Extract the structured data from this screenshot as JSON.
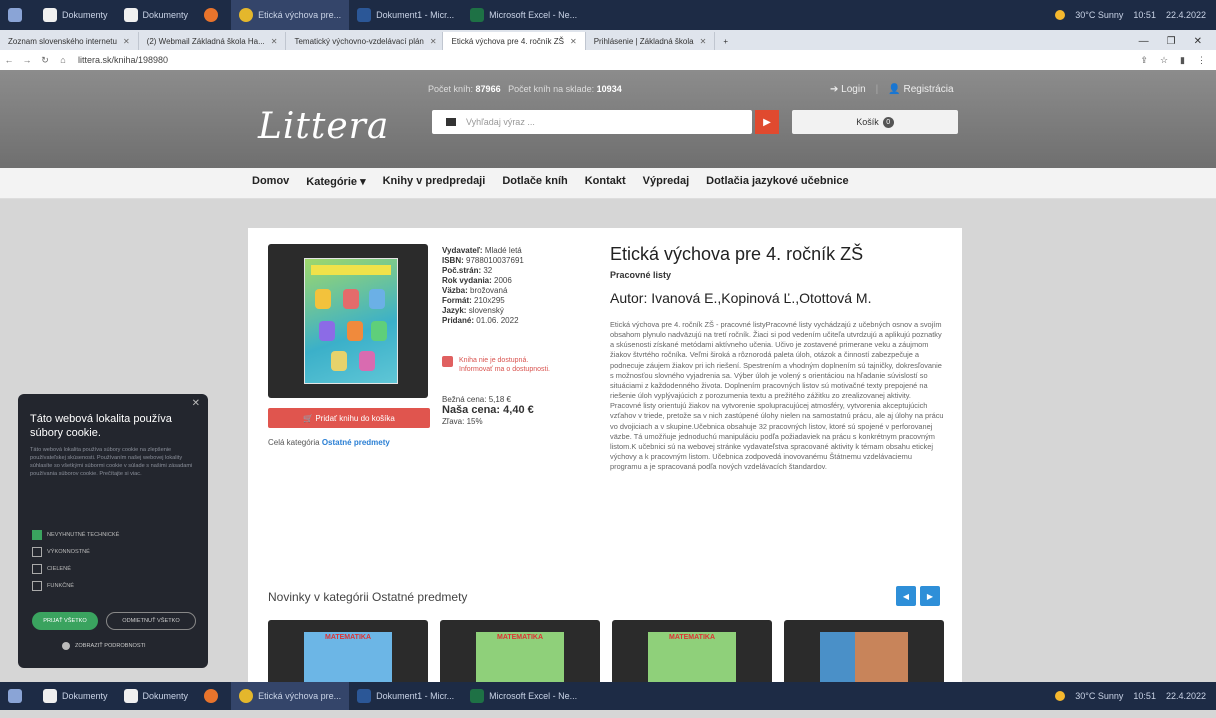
{
  "os": {
    "taskbar_items": [
      "Dokumenty",
      "Dokumenty",
      "",
      "Etická výchova pre...",
      "Dokument1 - Micr...",
      "Microsoft Excel - Ne..."
    ],
    "tray": [
      "30°C Sunny",
      "10:51",
      "22.4.2022"
    ]
  },
  "browser": {
    "tabs": [
      "Zoznam slovenského internetu",
      "(2) Webmail Základná škola Ha...",
      "Tematický výchovno-vzdelávací plán",
      "Etická výchova pre 4. ročník ZŠ",
      "Prihlásenie | Základná škola"
    ],
    "url": "littera.sk/kniha/198980"
  },
  "site": {
    "stats_label_1": "Počet kníh:",
    "stats_value_1": "87966",
    "stats_label_2": "Počet kníh na sklade:",
    "stats_value_2": "10934",
    "login": "Login",
    "register": "Registrácia",
    "logo": "Littera",
    "search_placeholder": "Vyhľadaj výraz ...",
    "cart_label": "Košík",
    "cart_count": "0",
    "nav": [
      "Domov",
      "Kategórie ▾",
      "Knihy v predpredaji",
      "Dotlače kníh",
      "Kontakt",
      "Výpredaj",
      "Dotlačia jazykové učebnice"
    ]
  },
  "book": {
    "publisher_label": "Vydavateľ:",
    "publisher": "Mladé letá",
    "isbn_label": "ISBN:",
    "isbn": "9788010037691",
    "pages_label": "Poč.strán:",
    "pages": "32",
    "year_label": "Rok vydania:",
    "year": "2006",
    "binding_label": "Väzba:",
    "binding": "brožovaná",
    "format_label": "Formát:",
    "format": "210x295",
    "language_label": "Jazyk:",
    "language": "slovenský",
    "added_label": "Pridané:",
    "added": "01.06. 2022",
    "notice": "Kniha nie je dostupná. Informovať ma o dostupnosti.",
    "regular_price_label": "Bežná cena:",
    "regular_price": "5,18 €",
    "our_price_label": "Naša cena:",
    "our_price": "4,40 €",
    "discount_label": "Zľava:",
    "discount": "15%",
    "cart_button": "Pridať knihu do košíka",
    "category_prefix": "Celá kategória",
    "category_link": "Ostatné predmety",
    "title": "Etická výchova pre 4. ročník ZŠ",
    "subtitle": "Pracovné listy",
    "author": "Autor: Ivanová E.,Kopinová Ľ.,Otottová M.",
    "description": "Etická výchova pre 4. ročník ZŠ - pracovné listyPracovné listy vychádzajú z učebných osnov a svojím obsahom plynulo nadväzujú na tretí ročník. Žiaci si pod vedením učiteľa utvrdzujú a aplikujú poznatky a skúsenosti získané metódami aktívneho učenia. Učivo je zostavené primerane veku a záujmom žiakov štvrtého ročníka. Veľmi široká a rôznorodá paleta úloh, otázok a činností zabezpečuje a podnecuje záujem žiakov pri ich riešení. Spestrením a vhodným doplnením sú tajničky, dokresľovanie s možnosťou slovného vyjadrenia sa. Výber úloh je volený s orientáciou na hľadanie súvislostí so situáciami z každodenného života. Doplnením pracovných listov sú motivačné texty prepojené na riešenie úloh vyplývajúcich z porozumenia textu a prežitého zážitku zo zrealizovanej aktivity. Pracovné listy orientujú žiakov na vytvorenie spolupracujúcej atmosféry, vytvorenia akceptujúcich vzťahov v triede, pretože sa v nich zastúpené úlohy nielen na samostatnú prácu, ale aj úlohy na prácu vo dvojiciach a v skupine.Učebnica obsahuje 32 pracovných listov, ktoré sú spojené v perforovanej väzbe. Tá umožňuje jednoduchú manipuláciu podľa požiadaviek na prácu s konkrétnym pracovným listom.K učebnici sú na webovej stránke vydavateľstva spracované aktivity k témam obsahu etickej výchovy a k pracovným listom. Učebnica zodpovedá inovovanému Štátnemu vzdelávaciemu programu a je spracovaná podľa nových vzdelávacích štandardov."
  },
  "news": {
    "title": "Novinky v kategórii Ostatné predmety",
    "books": [
      "MATEMATIKA",
      "MATEMATIKA",
      "MATEMATIKA",
      ""
    ]
  },
  "cookie": {
    "title": "Táto webová lokalita používa súbory cookie.",
    "text": "Táto webová lokalita používa súbory cookie na zlepšenie používateľskej skúsenosti. Používaním našej webovej lokality súhlasíte so všetkými súbormi cookie v súlade s našimi zásadami používania súborov cookie. Prečítajte si viac.",
    "options": [
      "NEVYHNUTNÉ TECHNICKÉ",
      "VÝKONNOSTNÉ",
      "CIELENÉ",
      "FUNKČNÉ"
    ],
    "accept": "PRIJAŤ VŠETKO",
    "reject": "ODMIETNUŤ VŠETKO",
    "details": "ZOBRAZIŤ PODROBNOSTI"
  }
}
